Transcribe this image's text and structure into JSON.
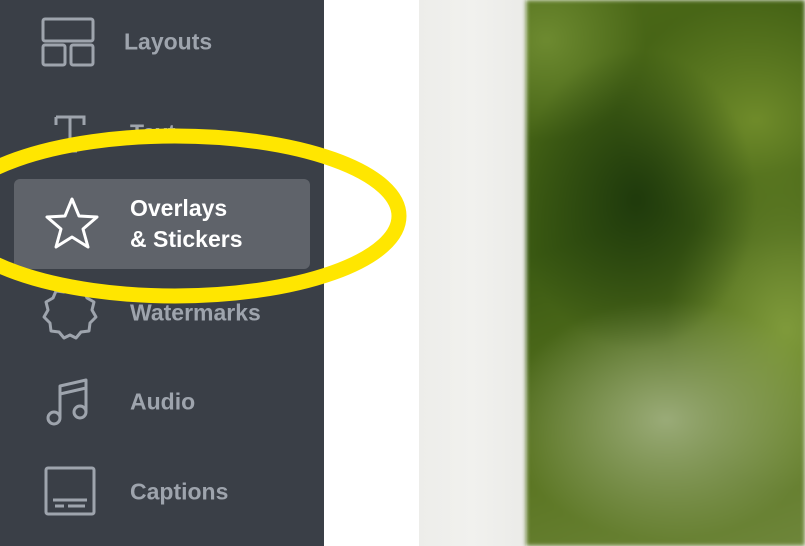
{
  "sidebar": {
    "items": [
      {
        "label": "Layouts",
        "icon": "layout-icon"
      },
      {
        "label": "Text",
        "icon": "text-icon"
      },
      {
        "label_line1": "Overlays",
        "label_line2": "& Stickers",
        "icon": "star-icon",
        "active": true
      },
      {
        "label": "Watermarks",
        "icon": "badge-icon"
      },
      {
        "label": "Audio",
        "icon": "music-note-icon"
      },
      {
        "label": "Captions",
        "icon": "captions-icon"
      }
    ]
  },
  "colors": {
    "sidebar_bg": "#3a3f47",
    "active_item_bg": "#5f636a",
    "inactive_label": "#9ea4ad",
    "active_label": "#ffffff",
    "highlight_ring": "#ffe600"
  }
}
